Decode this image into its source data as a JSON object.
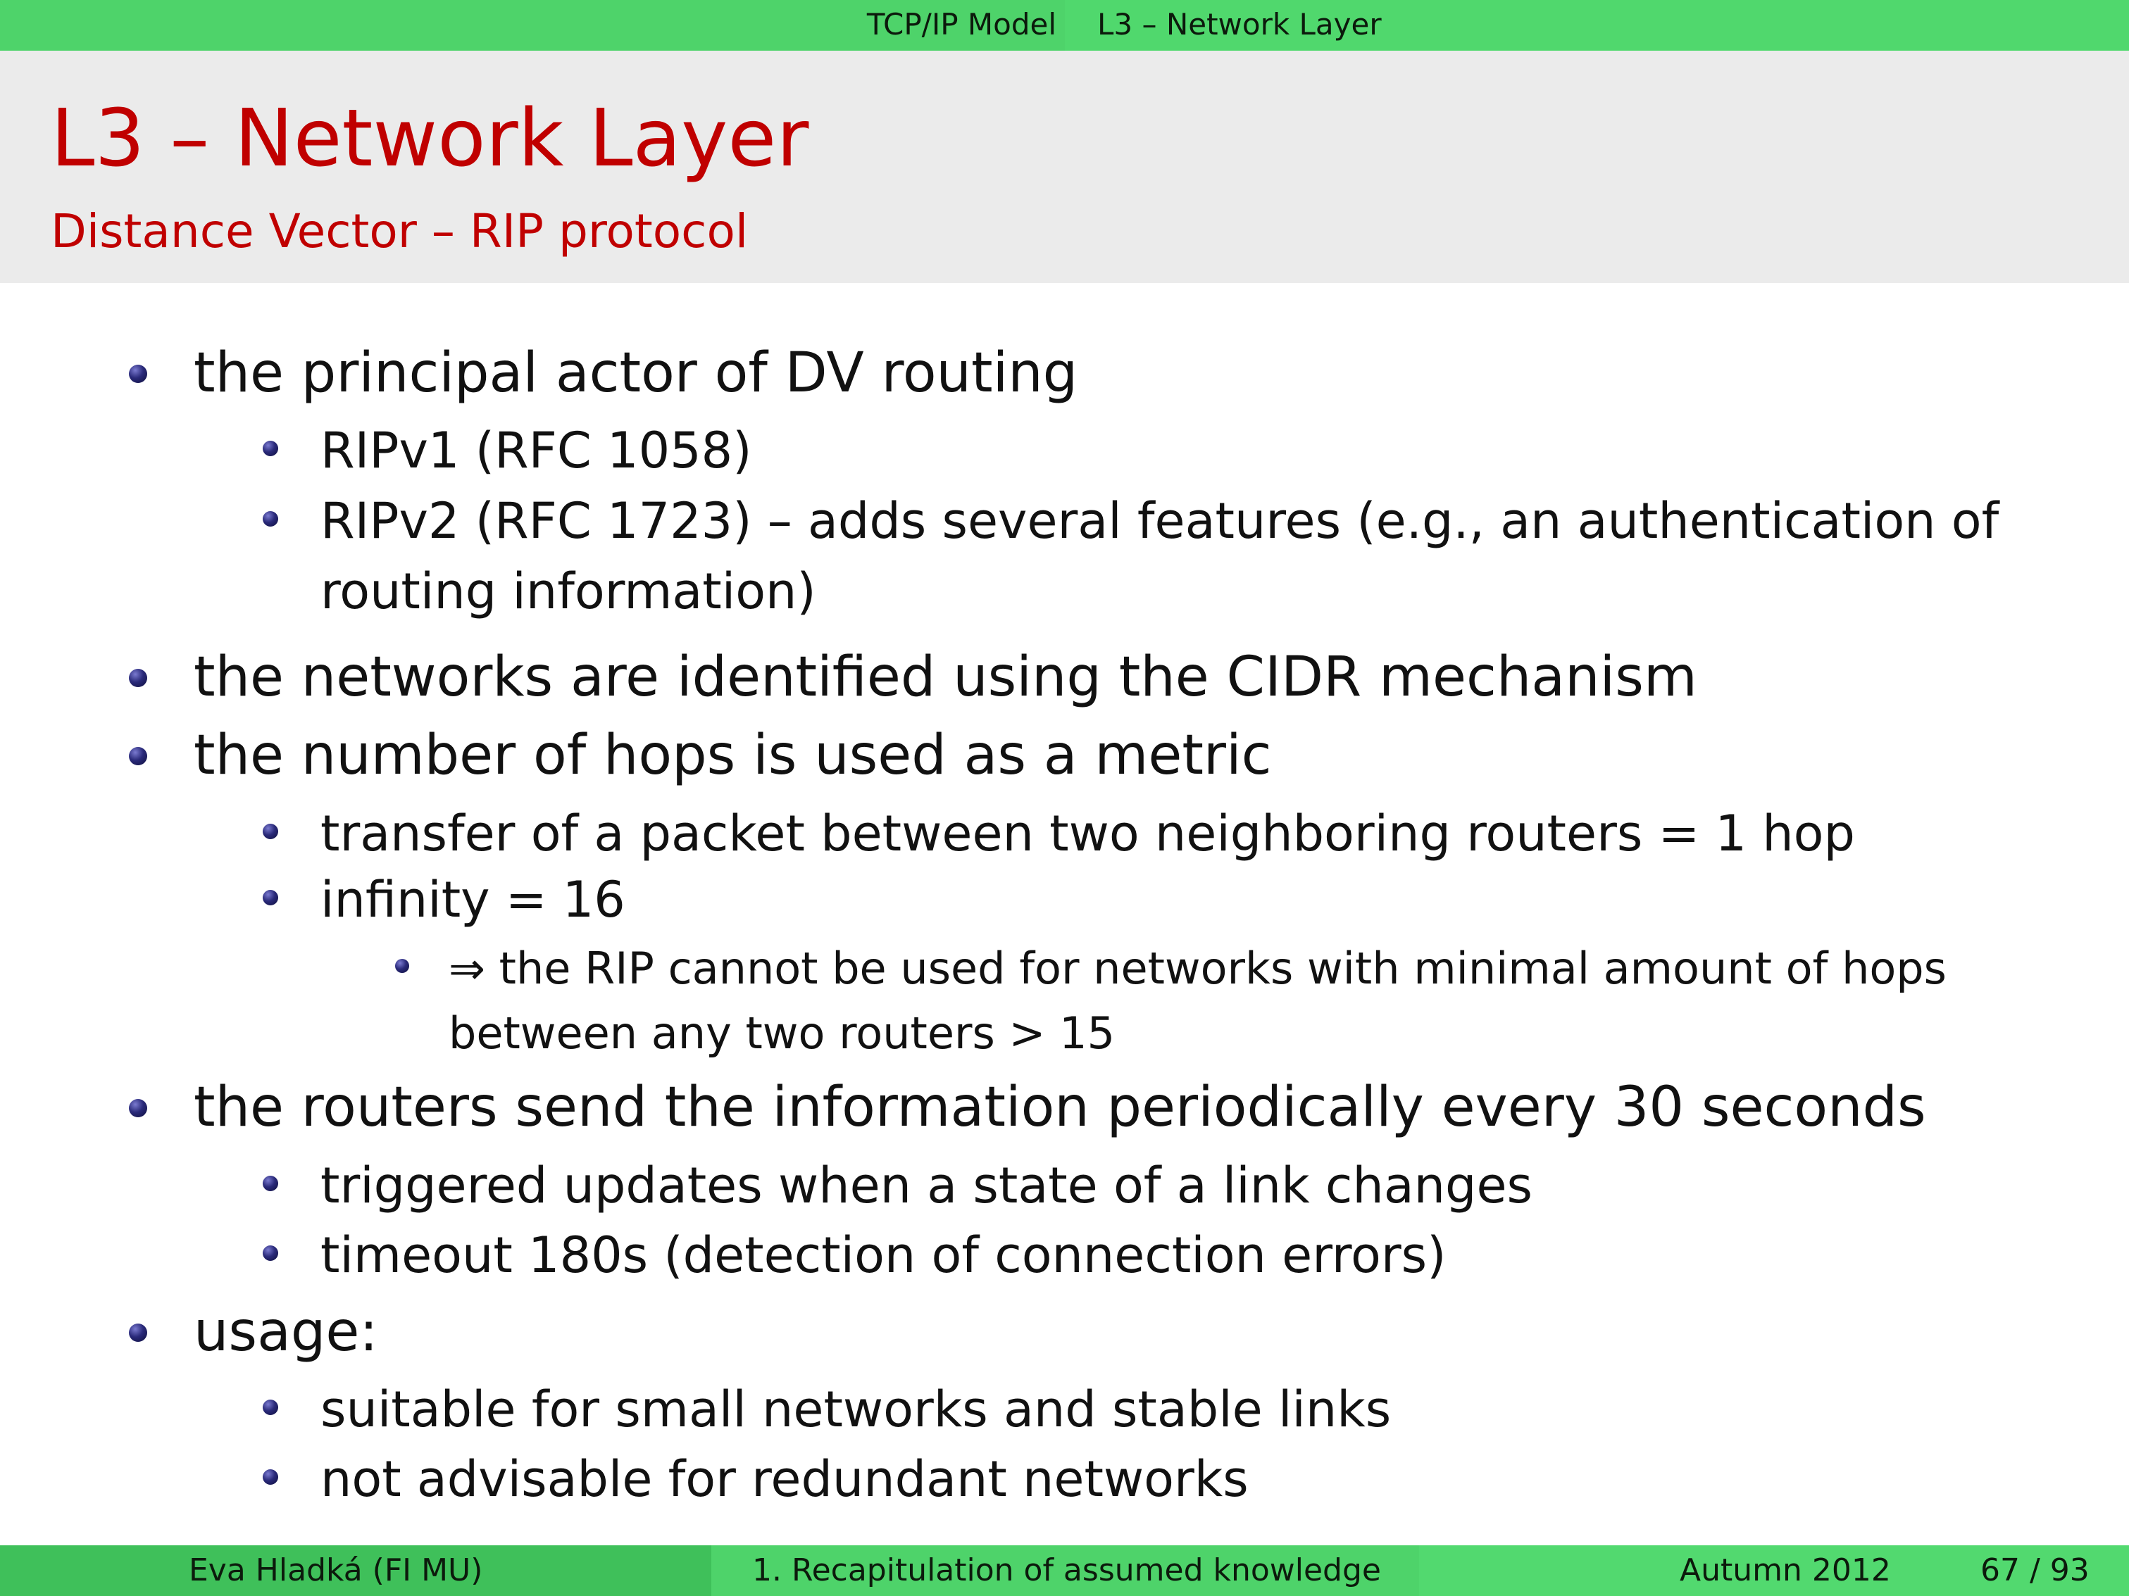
{
  "header": {
    "section": "TCP/IP Model",
    "subsection": "L3 – Network Layer"
  },
  "frame": {
    "title": "L3 – Network Layer",
    "subtitle": "Distance Vector – RIP protocol"
  },
  "items": [
    {
      "text": "the principal actor of DV routing"
    },
    {
      "text": "RIPv1 (RFC 1058)"
    },
    {
      "text": "RIPv2 (RFC 1723) – adds several features (e.g., an authentication of",
      "cont": "routing information)"
    },
    {
      "text": "the networks are identified using the CIDR mechanism"
    },
    {
      "text": "the number of hops is used as a metric"
    },
    {
      "text": "transfer of a packet between two neighboring routers = 1 hop"
    },
    {
      "text": "infinity = 16"
    },
    {
      "text": "⇒ the RIP cannot be used for networks with minimal amount of hops",
      "cont": "between any two routers > 15"
    },
    {
      "text": "the routers send the information periodically every 30 seconds"
    },
    {
      "text": "triggered updates when a state of a link changes"
    },
    {
      "text": "timeout 180s (detection of connection errors)"
    },
    {
      "text": "usage:"
    },
    {
      "text": "suitable for small networks and stable links"
    },
    {
      "text": "not advisable for redundant networks"
    }
  ],
  "footer": {
    "author": "Eva Hladká  (FI MU)",
    "talk": "1. Recapitulation of assumed knowledge",
    "date": "Autumn 2012",
    "page": "67 / 93"
  }
}
